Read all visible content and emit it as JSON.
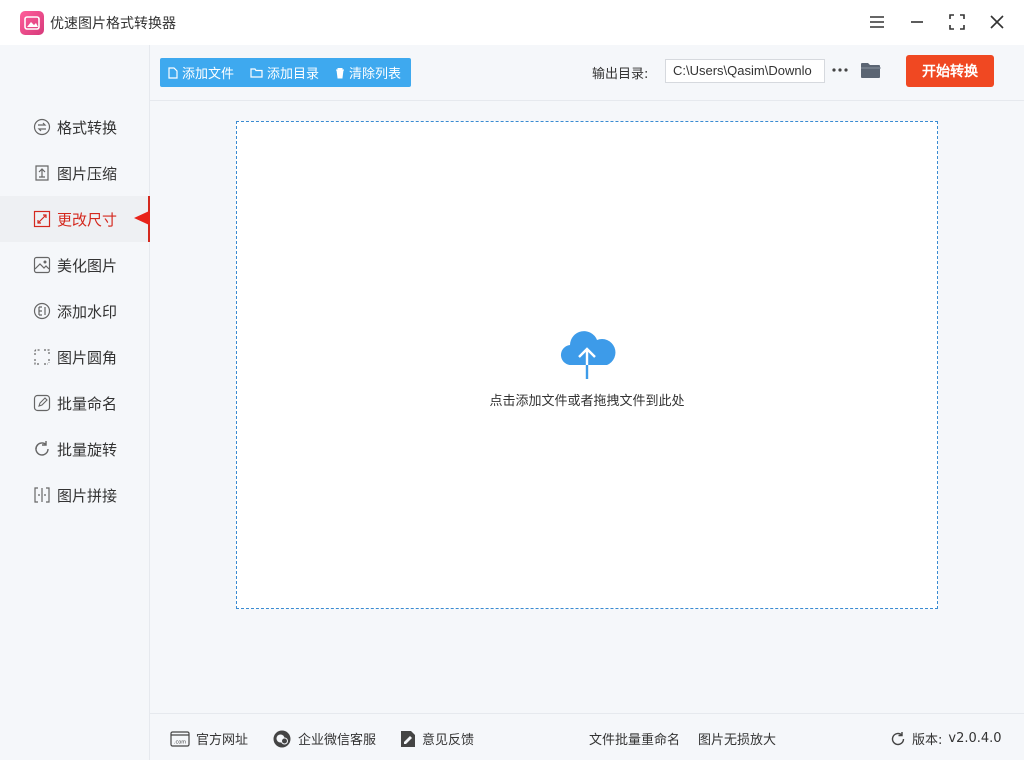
{
  "app": {
    "title": "优速图片格式转换器"
  },
  "sidebar": {
    "items": [
      {
        "label": "格式转换",
        "icon": "format-convert-icon"
      },
      {
        "label": "图片压缩",
        "icon": "compress-icon"
      },
      {
        "label": "更改尺寸",
        "icon": "resize-icon"
      },
      {
        "label": "美化图片",
        "icon": "beautify-icon"
      },
      {
        "label": "添加水印",
        "icon": "watermark-icon"
      },
      {
        "label": "图片圆角",
        "icon": "round-corner-icon"
      },
      {
        "label": "批量命名",
        "icon": "rename-icon"
      },
      {
        "label": "批量旋转",
        "icon": "rotate-icon"
      },
      {
        "label": "图片拼接",
        "icon": "stitch-icon"
      }
    ],
    "active_label": "更改尺寸"
  },
  "toolbar": {
    "add_file": "添加文件",
    "add_dir": "添加目录",
    "clear_list": "清除列表",
    "output_label": "输出目录:",
    "output_path": "C:\\Users\\Qasim\\Downlo",
    "start": "开始转换"
  },
  "main": {
    "drop_hint": "点击添加文件或者拖拽文件到此处"
  },
  "footer": {
    "website": "官方网址",
    "wechat": "企业微信客服",
    "feedback": "意见反馈",
    "batch_rename": "文件批量重命名",
    "lossless": "图片无损放大",
    "version_label": "版本:",
    "version": "v2.0.4.0"
  },
  "colors": {
    "accent": "#3ea9ef",
    "start": "#f04822",
    "active": "#d4281e"
  }
}
